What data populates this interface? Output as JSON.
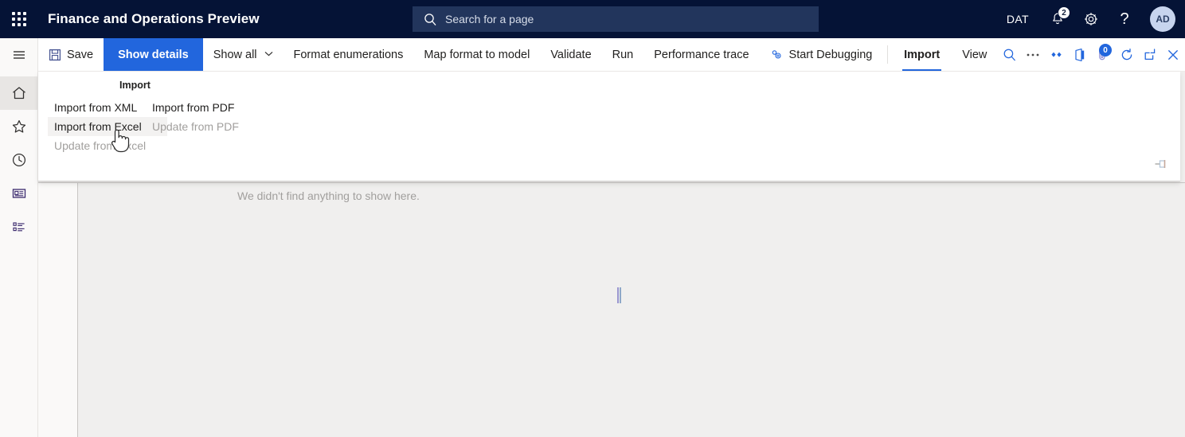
{
  "header": {
    "app_title": "Finance and Operations Preview",
    "waffle_icon": "app-launcher-icon",
    "search": {
      "placeholder": "Search for a page",
      "icon": "search-icon"
    },
    "company": "DAT",
    "notifications": {
      "icon": "bell-icon",
      "count": "2"
    },
    "settings_icon": "gear-icon",
    "help_icon": "question-mark-icon",
    "avatar_initials": "AD"
  },
  "rail": {
    "items": [
      {
        "name": "hamburger-menu",
        "icon": "hamburger-icon",
        "selected": false
      },
      {
        "name": "home",
        "icon": "home-icon",
        "selected": true
      },
      {
        "name": "favorites",
        "icon": "star-icon",
        "selected": false
      },
      {
        "name": "recent",
        "icon": "clock-icon",
        "selected": false
      },
      {
        "name": "workspaces",
        "icon": "workspace-icon",
        "selected": false
      },
      {
        "name": "modules",
        "icon": "list-icon",
        "selected": false
      }
    ]
  },
  "command_bar": {
    "save_label": "Save",
    "save_icon": "save-floppy-icon",
    "show_details_label": "Show details",
    "show_all_label": "Show all",
    "show_all_chevron": "chevron-down-icon",
    "format_enumerations_label": "Format enumerations",
    "map_format_to_model_label": "Map format to model",
    "validate_label": "Validate",
    "run_label": "Run",
    "performance_trace_label": "Performance trace",
    "start_debugging_label": "Start Debugging",
    "start_debugging_icon": "debug-gears-icon",
    "tabs": [
      {
        "label": "Import",
        "active": true
      },
      {
        "label": "View",
        "active": false
      }
    ],
    "icons": [
      {
        "name": "search-icon",
        "badge": null
      },
      {
        "name": "overflow-ellipsis-icon",
        "badge": null
      },
      {
        "name": "personalize-diamond-icon",
        "badge": null
      },
      {
        "name": "office-app-icon",
        "badge": null
      },
      {
        "name": "attachments-icon",
        "badge": "0"
      },
      {
        "name": "refresh-icon",
        "badge": null
      },
      {
        "name": "open-in-new-window-icon",
        "badge": null
      },
      {
        "name": "close-icon",
        "badge": null
      }
    ]
  },
  "panel": {
    "group_title": "Import",
    "pin_icon": "pin-icon",
    "columns": [
      {
        "items": [
          {
            "label": "Import from XML",
            "state": "normal"
          },
          {
            "label": "Import from Excel",
            "state": "hovered"
          },
          {
            "label": "Update from Excel",
            "state": "disabled"
          }
        ]
      },
      {
        "items": [
          {
            "label": "Import from PDF",
            "state": "normal"
          },
          {
            "label": "Update from PDF",
            "state": "disabled"
          }
        ]
      }
    ]
  },
  "content": {
    "empty_message": "We didn't find anything to show here."
  },
  "colors": {
    "header_bg": "#051336",
    "accent_blue": "#2266dd",
    "search_bg": "#22355c",
    "content_bg": "#f0efee",
    "disabled_text": "#a19f9d"
  },
  "cursor": {
    "type": "pointing-hand"
  }
}
